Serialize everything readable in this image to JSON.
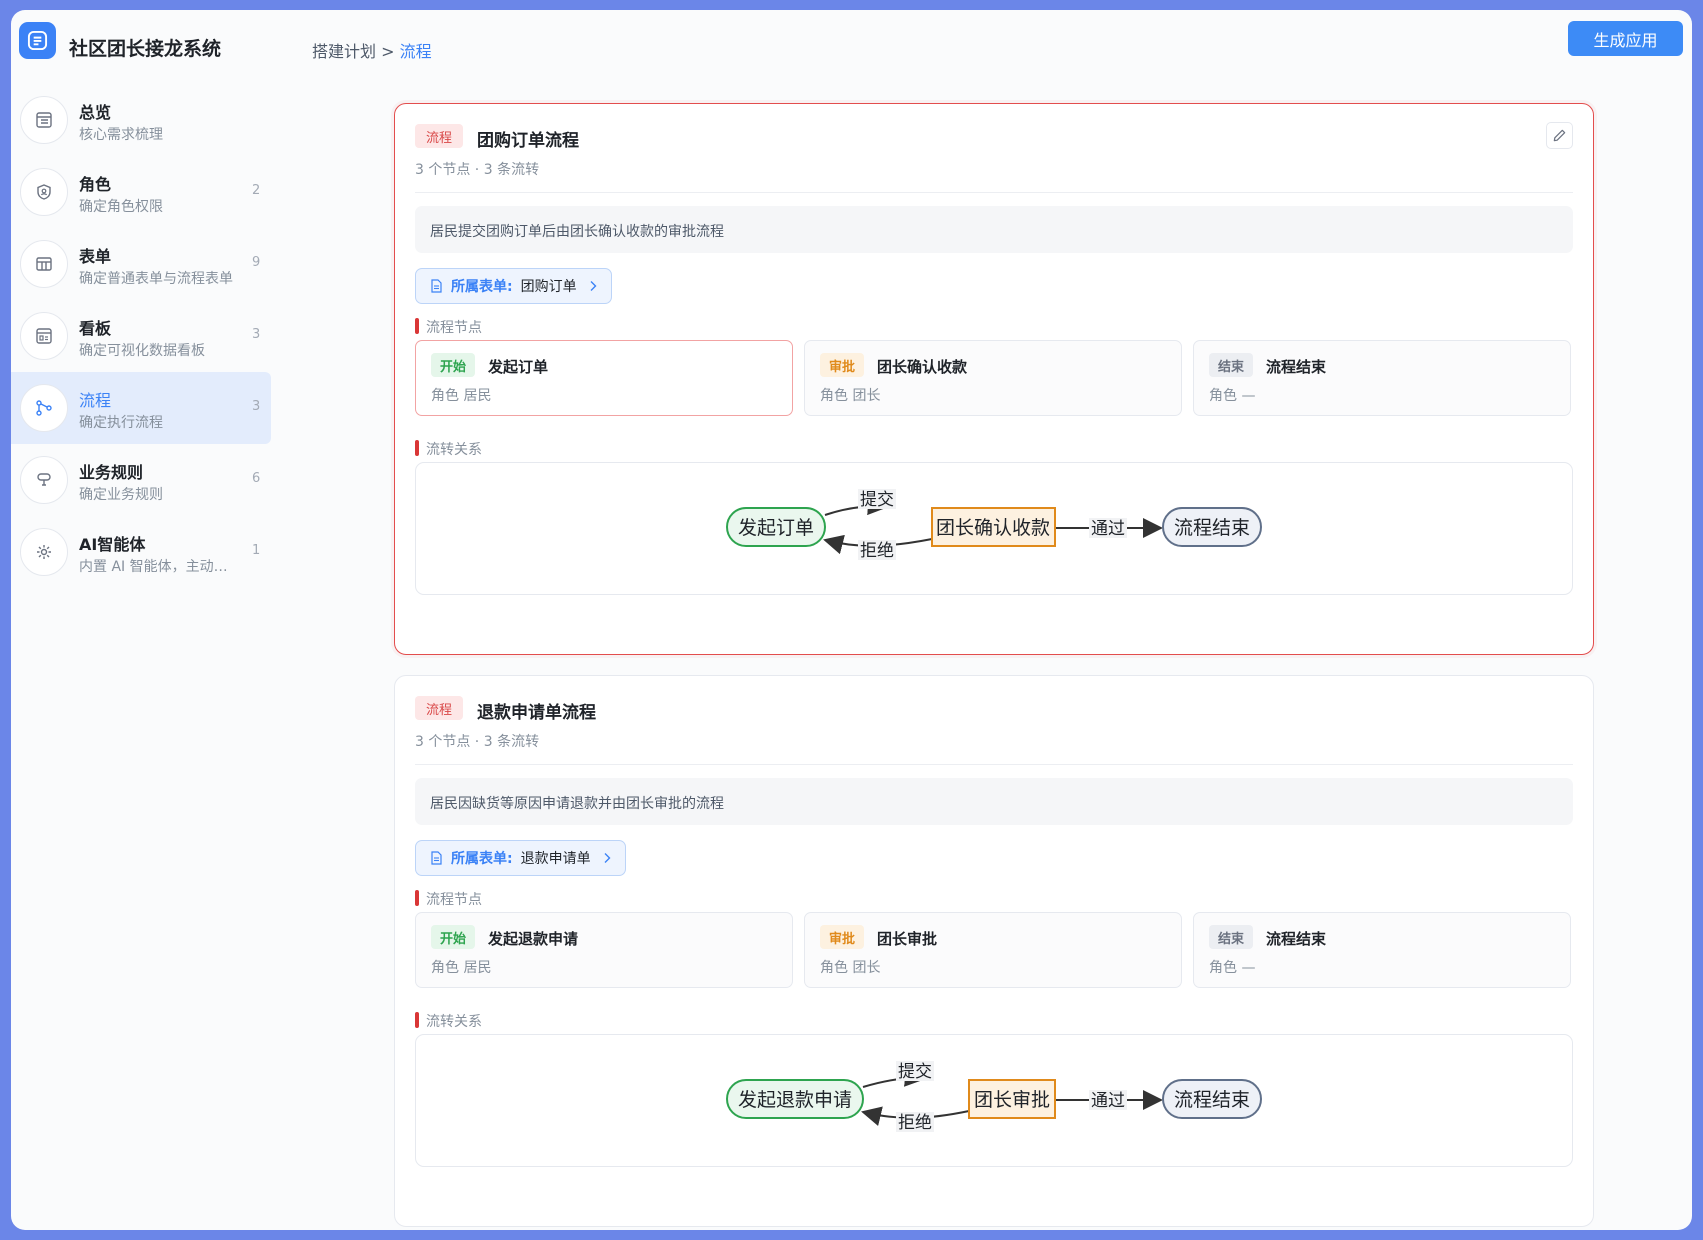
{
  "app": {
    "title": "社区团长接龙系统",
    "generate_label": "生成应用"
  },
  "breadcrumb": {
    "parent": "搭建计划 >",
    "current": "流程"
  },
  "sidebar": {
    "items": [
      {
        "title": "总览",
        "sub": "核心需求梳理",
        "count": "",
        "icon": "overview-icon"
      },
      {
        "title": "角色",
        "sub": "确定角色权限",
        "count": "2",
        "icon": "role-shield-icon"
      },
      {
        "title": "表单",
        "sub": "确定普通表单与流程表单",
        "count": "9",
        "icon": "form-table-icon"
      },
      {
        "title": "看板",
        "sub": "确定可视化数据看板",
        "count": "3",
        "icon": "dashboard-icon"
      },
      {
        "title": "流程",
        "sub": "确定执行流程",
        "count": "3",
        "icon": "flow-icon"
      },
      {
        "title": "业务规则",
        "sub": "确定业务规则",
        "count": "6",
        "icon": "rule-icon"
      },
      {
        "title": "AI智能体",
        "sub": "内置 AI 智能体，主动处理业务",
        "count": "1",
        "icon": "ai-gear-icon"
      }
    ]
  },
  "flows": [
    {
      "tag": "流程",
      "title": "团购订单流程",
      "meta": "3 个节点 · 3 条流转",
      "description": "居民提交团购订单后由团长确认收款的审批流程",
      "form_label": "所属表单:",
      "form_value": "团购订单",
      "nodes_label": "流程节点",
      "edges_label": "流转关系",
      "nodes": [
        {
          "type": "开始",
          "name": "发起订单",
          "role": "角色 居民"
        },
        {
          "type": "审批",
          "name": "团长确认收款",
          "role": "角色 团长"
        },
        {
          "type": "结束",
          "name": "流程结束",
          "role": "角色 —"
        }
      ],
      "diagram": {
        "n1": "发起订单",
        "n2": "团长确认收款",
        "n3": "流程结束",
        "submit": "提交",
        "reject": "拒绝",
        "pass": "通过"
      }
    },
    {
      "tag": "流程",
      "title": "退款申请单流程",
      "meta": "3 个节点 · 3 条流转",
      "description": "居民因缺货等原因申请退款并由团长审批的流程",
      "form_label": "所属表单:",
      "form_value": "退款申请单",
      "nodes_label": "流程节点",
      "edges_label": "流转关系",
      "nodes": [
        {
          "type": "开始",
          "name": "发起退款申请",
          "role": "角色 居民"
        },
        {
          "type": "审批",
          "name": "团长审批",
          "role": "角色 团长"
        },
        {
          "type": "结束",
          "name": "流程结束",
          "role": "角色 —"
        }
      ],
      "diagram": {
        "n1": "发起退款申请",
        "n2": "团长审批",
        "n3": "流程结束",
        "submit": "提交",
        "reject": "拒绝",
        "pass": "通过"
      }
    }
  ],
  "colors": {
    "accent": "#3b82f6",
    "flow_tag": "#d94848",
    "start_green": "#2ea44f",
    "approve_orange": "#e08a1b"
  }
}
